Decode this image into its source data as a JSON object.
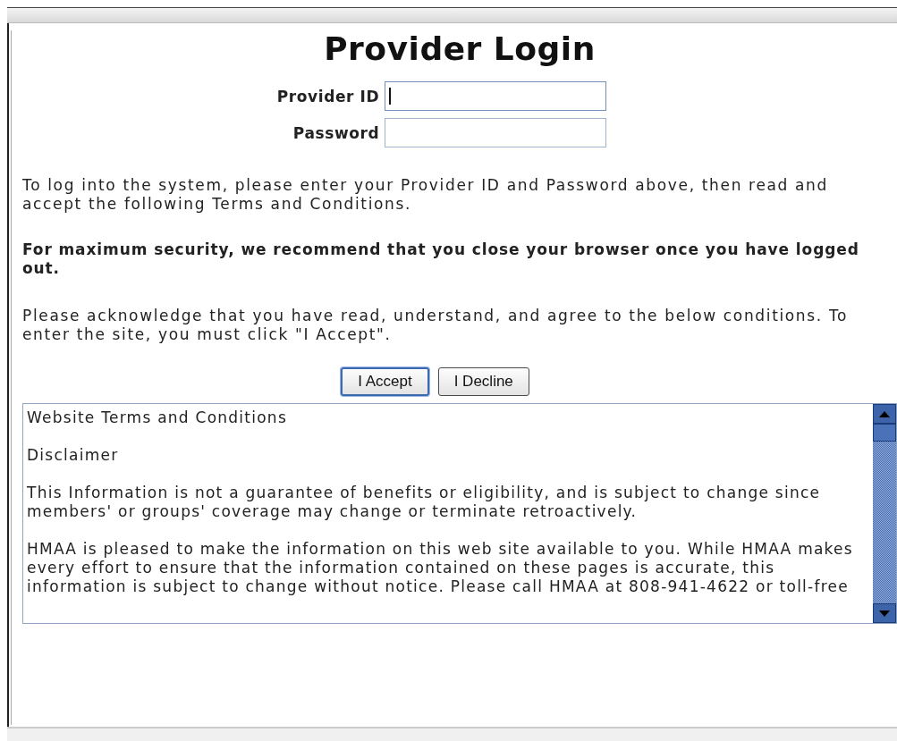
{
  "title": "Provider Login",
  "fields": [
    {
      "label": "Provider ID",
      "focused": true
    },
    {
      "label": "Password",
      "focused": false
    }
  ],
  "paragraphs": [
    {
      "text": "To log into the system, please enter your Provider ID and Password above, then read and accept the following Terms and Conditions.",
      "bold": false
    },
    {
      "text": "For maximum security, we recommend that you close your browser once you have logged out.",
      "bold": true
    },
    {
      "text": "Please acknowledge that you have read, understand, and agree to the below conditions. To enter the site, you must click \"I Accept\".",
      "bold": false
    }
  ],
  "buttons": [
    {
      "label": "I Accept",
      "selected": true
    },
    {
      "label": "I Decline",
      "selected": false
    }
  ],
  "terms": [
    "Website Terms and Conditions",
    "Disclaimer",
    "This Information is not a guarantee of benefits or eligibility, and is subject to change since members' or groups' coverage may change or terminate retroactively.",
    "HMAA is pleased to make the information on this web site available to you. While HMAA makes every effort to ensure that the information contained on these pages is accurate, this information is subject to change without notice. Please call HMAA at 808-941-4622 or toll-free"
  ]
}
